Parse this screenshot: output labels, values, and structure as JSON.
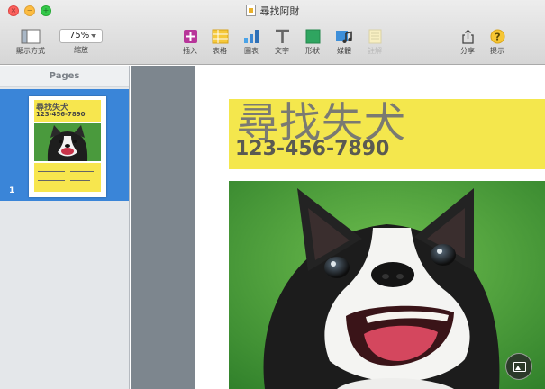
{
  "window": {
    "title": "尋找阿財",
    "title_icon": "pages-doc-icon"
  },
  "toolbar": {
    "view": {
      "label": "顯示方式",
      "icon": "sidebar-view-icon"
    },
    "zoom": {
      "label": "縮放",
      "value": "75%"
    },
    "insert": {
      "label": "插入",
      "icon": "insert-plus-icon"
    },
    "table": {
      "label": "表格",
      "icon": "table-icon"
    },
    "chart": {
      "label": "圖表",
      "icon": "chart-icon"
    },
    "text": {
      "label": "文字",
      "icon": "text-icon"
    },
    "shape": {
      "label": "形狀",
      "icon": "shape-icon"
    },
    "media": {
      "label": "媒體",
      "icon": "media-icon"
    },
    "comment": {
      "label": "註解",
      "icon": "comment-icon",
      "enabled": false
    },
    "share": {
      "label": "分享",
      "icon": "share-icon"
    },
    "help": {
      "label": "提示",
      "icon": "help-icon"
    }
  },
  "sidebar": {
    "heading": "Pages",
    "pages": [
      {
        "number": "1",
        "title": "尋找失犬",
        "phone": "123-456-7890",
        "selected": true
      }
    ]
  },
  "document": {
    "headline": "尋找失犬",
    "phone": "123-456-7890",
    "band_color": "#f4e74d",
    "photo_subject": "boston-terrier-dog-photo"
  },
  "colors": {
    "selection": "#3a85d8",
    "sidebar_bg": "#e4e7ea",
    "gutter": "#7d868e"
  }
}
